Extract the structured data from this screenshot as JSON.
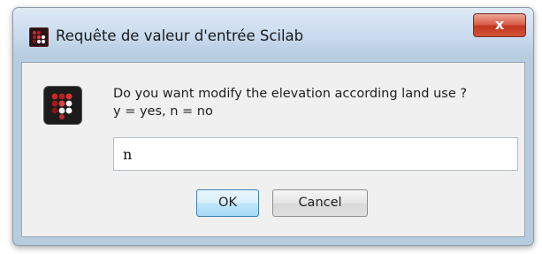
{
  "window": {
    "title": "Requête de valeur d'entrée Scilab",
    "close_label": "x"
  },
  "dialog": {
    "message": "Do you want modify the elevation according land use ?\ny = yes, n = no",
    "input_value": "n",
    "ok_label": "OK",
    "cancel_label": "Cancel"
  },
  "icons": {
    "app": "scilab-icon",
    "message": "scilab-icon",
    "close": "close-icon"
  },
  "colors": {
    "title_bar": "#c9dbee",
    "close_button": "#c3361f",
    "client_area": "#f0f0f0",
    "default_button": "#bee6fd"
  }
}
